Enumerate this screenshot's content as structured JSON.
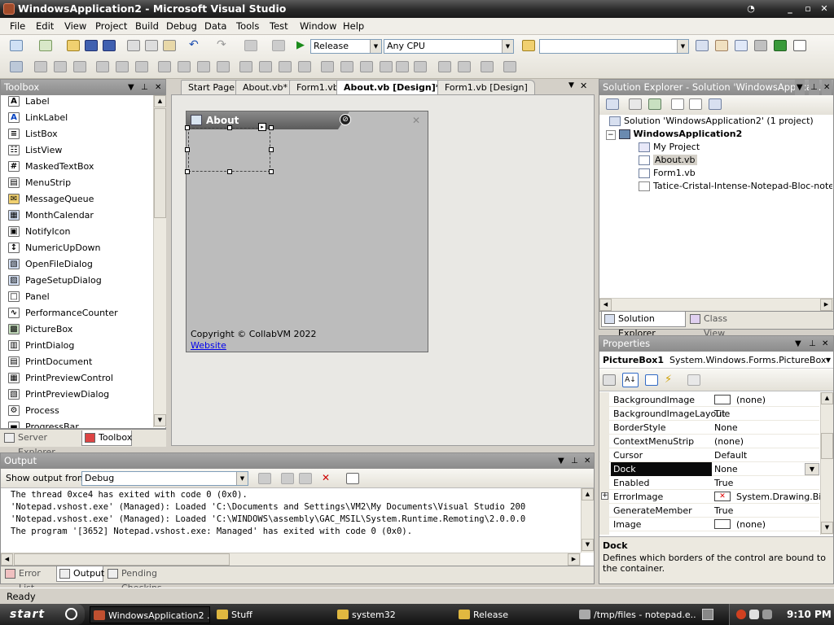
{
  "window": {
    "title": "WindowsApplication2 - Microsoft Visual Studio"
  },
  "menu": [
    "File",
    "Edit",
    "View",
    "Project",
    "Build",
    "Debug",
    "Data",
    "Tools",
    "Test",
    "Window",
    "Help"
  ],
  "toolbar": {
    "configuration": "Release",
    "platform": "Any CPU"
  },
  "toolbox": {
    "title": "Toolbox",
    "items": [
      {
        "label": "Label",
        "icon": "A"
      },
      {
        "label": "LinkLabel",
        "icon": "A"
      },
      {
        "label": "ListBox",
        "icon": "≡"
      },
      {
        "label": "ListView",
        "icon": "☷"
      },
      {
        "label": "MaskedTextBox",
        "icon": "#"
      },
      {
        "label": "MenuStrip",
        "icon": "▤"
      },
      {
        "label": "MessageQueue",
        "icon": "✉"
      },
      {
        "label": "MonthCalendar",
        "icon": "▦"
      },
      {
        "label": "NotifyIcon",
        "icon": "▣"
      },
      {
        "label": "NumericUpDown",
        "icon": "↕"
      },
      {
        "label": "OpenFileDialog",
        "icon": "▧"
      },
      {
        "label": "PageSetupDialog",
        "icon": "▨"
      },
      {
        "label": "Panel",
        "icon": "□"
      },
      {
        "label": "PerformanceCounter",
        "icon": "∿"
      },
      {
        "label": "PictureBox",
        "icon": "▩"
      },
      {
        "label": "PrintDialog",
        "icon": "▥"
      },
      {
        "label": "PrintDocument",
        "icon": "▤"
      },
      {
        "label": "PrintPreviewControl",
        "icon": "▦"
      },
      {
        "label": "PrintPreviewDialog",
        "icon": "▧"
      },
      {
        "label": "Process",
        "icon": "⚙"
      },
      {
        "label": "ProgressBar",
        "icon": "▬"
      }
    ],
    "bottom_tabs": [
      "Server Explorer",
      "Toolbox"
    ]
  },
  "doc_tabs": [
    "Start Page",
    "About.vb*",
    "Form1.vb",
    "About.vb [Design]*",
    "Form1.vb [Design]"
  ],
  "form": {
    "title": "About",
    "copyright": "Copyright © CollabVM 2022",
    "link": "Website"
  },
  "solution_explorer": {
    "title": "Solution Explorer - Solution 'WindowsApplicati...",
    "items": [
      {
        "label": "Solution 'WindowsApplication2' (1 project)"
      },
      {
        "label": "WindowsApplication2"
      },
      {
        "label": "My Project"
      },
      {
        "label": "About.vb"
      },
      {
        "label": "Form1.vb"
      },
      {
        "label": "Tatice-Cristal-Intense-Notepad-Bloc-notes.ico"
      }
    ],
    "bottom_tabs": [
      "Solution Explorer",
      "Class View"
    ]
  },
  "properties": {
    "title": "Properties",
    "object_name": "PictureBox1",
    "object_type": "System.Windows.Forms.PictureBox",
    "rows": [
      {
        "name": "BackgroundImage",
        "value": "(none)"
      },
      {
        "name": "BackgroundImageLayout",
        "value": "Tile"
      },
      {
        "name": "BorderStyle",
        "value": "None"
      },
      {
        "name": "ContextMenuStrip",
        "value": "(none)"
      },
      {
        "name": "Cursor",
        "value": "Default"
      },
      {
        "name": "Dock",
        "value": "None"
      },
      {
        "name": "Enabled",
        "value": "True"
      },
      {
        "name": "ErrorImage",
        "value": "System.Drawing.Bitm"
      },
      {
        "name": "GenerateMember",
        "value": "True"
      },
      {
        "name": "Image",
        "value": "(none)"
      }
    ],
    "desc_title": "Dock",
    "desc_text": "Defines which borders of the control are bound to the container."
  },
  "output": {
    "title": "Output",
    "show_from_label": "Show output from:",
    "source": "Debug",
    "lines": [
      "The thread 0xce4 has exited with code 0 (0x0).",
      "'Notepad.vshost.exe' (Managed): Loaded 'C:\\Documents and Settings\\VM2\\My Documents\\Visual Studio 200",
      "'Notepad.vshost.exe' (Managed): Loaded 'C:\\WINDOWS\\assembly\\GAC_MSIL\\System.Runtime.Remoting\\2.0.0.0",
      "The program '[3652] Notepad.vshost.exe: Managed' has exited with code 0 (0x0)."
    ],
    "bottom_tabs": [
      "Error List",
      "Output",
      "Pending Checkins"
    ]
  },
  "status": "Ready",
  "taskbar": {
    "start": "start",
    "tasks": [
      "WindowsApplication2 ...",
      "Stuff",
      "system32",
      "Release",
      "/tmp/files - notepad.e..."
    ],
    "clock": "9:10 PM"
  }
}
